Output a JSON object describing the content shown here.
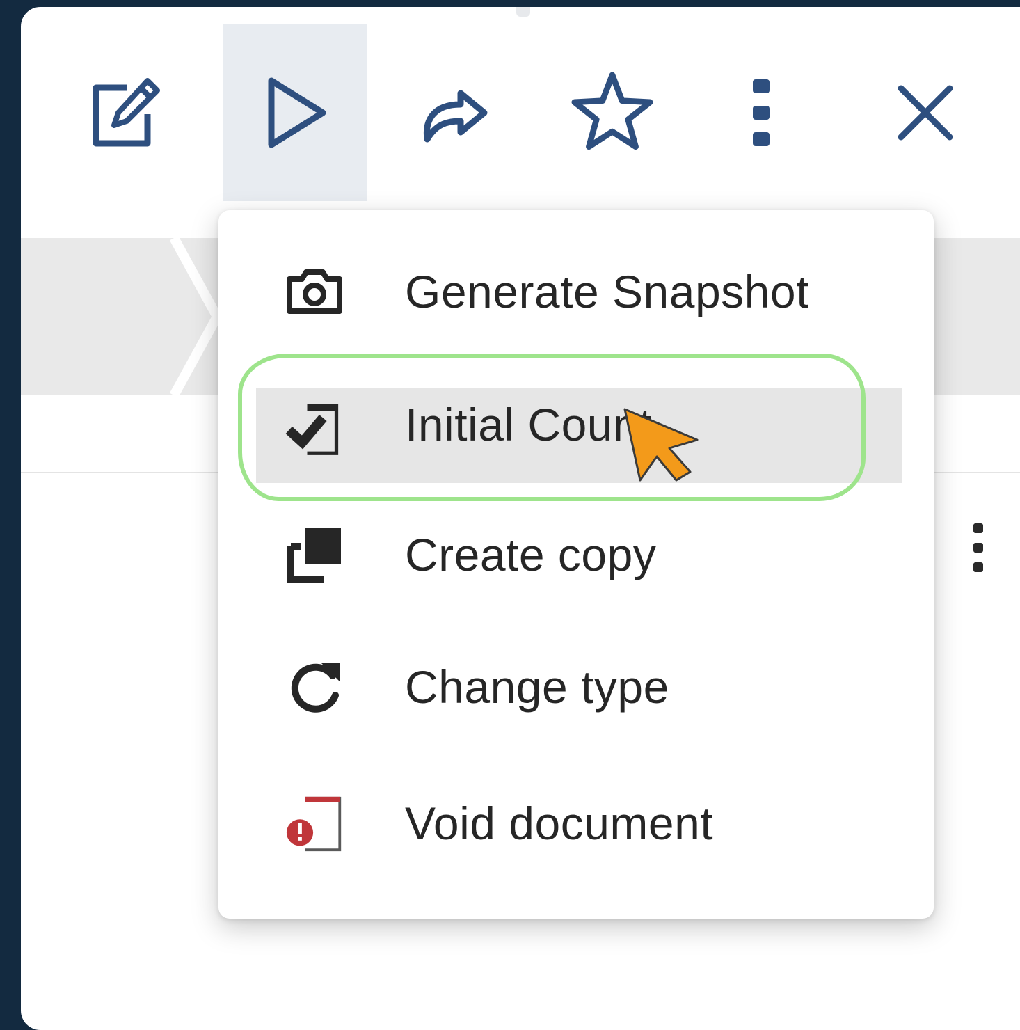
{
  "toolbar": {
    "buttons": [
      {
        "name": "edit",
        "icon": "edit-icon"
      },
      {
        "name": "run",
        "icon": "play-icon",
        "active": true
      },
      {
        "name": "share",
        "icon": "share-forward-icon"
      },
      {
        "name": "favorite",
        "icon": "star-icon"
      },
      {
        "name": "more",
        "icon": "more-vertical-icon"
      },
      {
        "name": "close",
        "icon": "close-icon"
      }
    ],
    "icon_color": "#2e4f7f",
    "active_bg": "#e8ecf1"
  },
  "menu": {
    "items": [
      {
        "label": "Generate Snapshot",
        "icon": "camera-icon"
      },
      {
        "label": "Initial Count",
        "icon": "check-document-icon",
        "hovered": true
      },
      {
        "label": "Create copy",
        "icon": "copy-icon"
      },
      {
        "label": "Change type",
        "icon": "refresh-icon"
      },
      {
        "label": "Void document",
        "icon": "void-document-icon",
        "icon_color": "#c0363a"
      }
    ],
    "highlight_color": "#9ee48c"
  },
  "cursor": {
    "icon": "pointer-cursor-icon",
    "color": "#f39a1a"
  }
}
